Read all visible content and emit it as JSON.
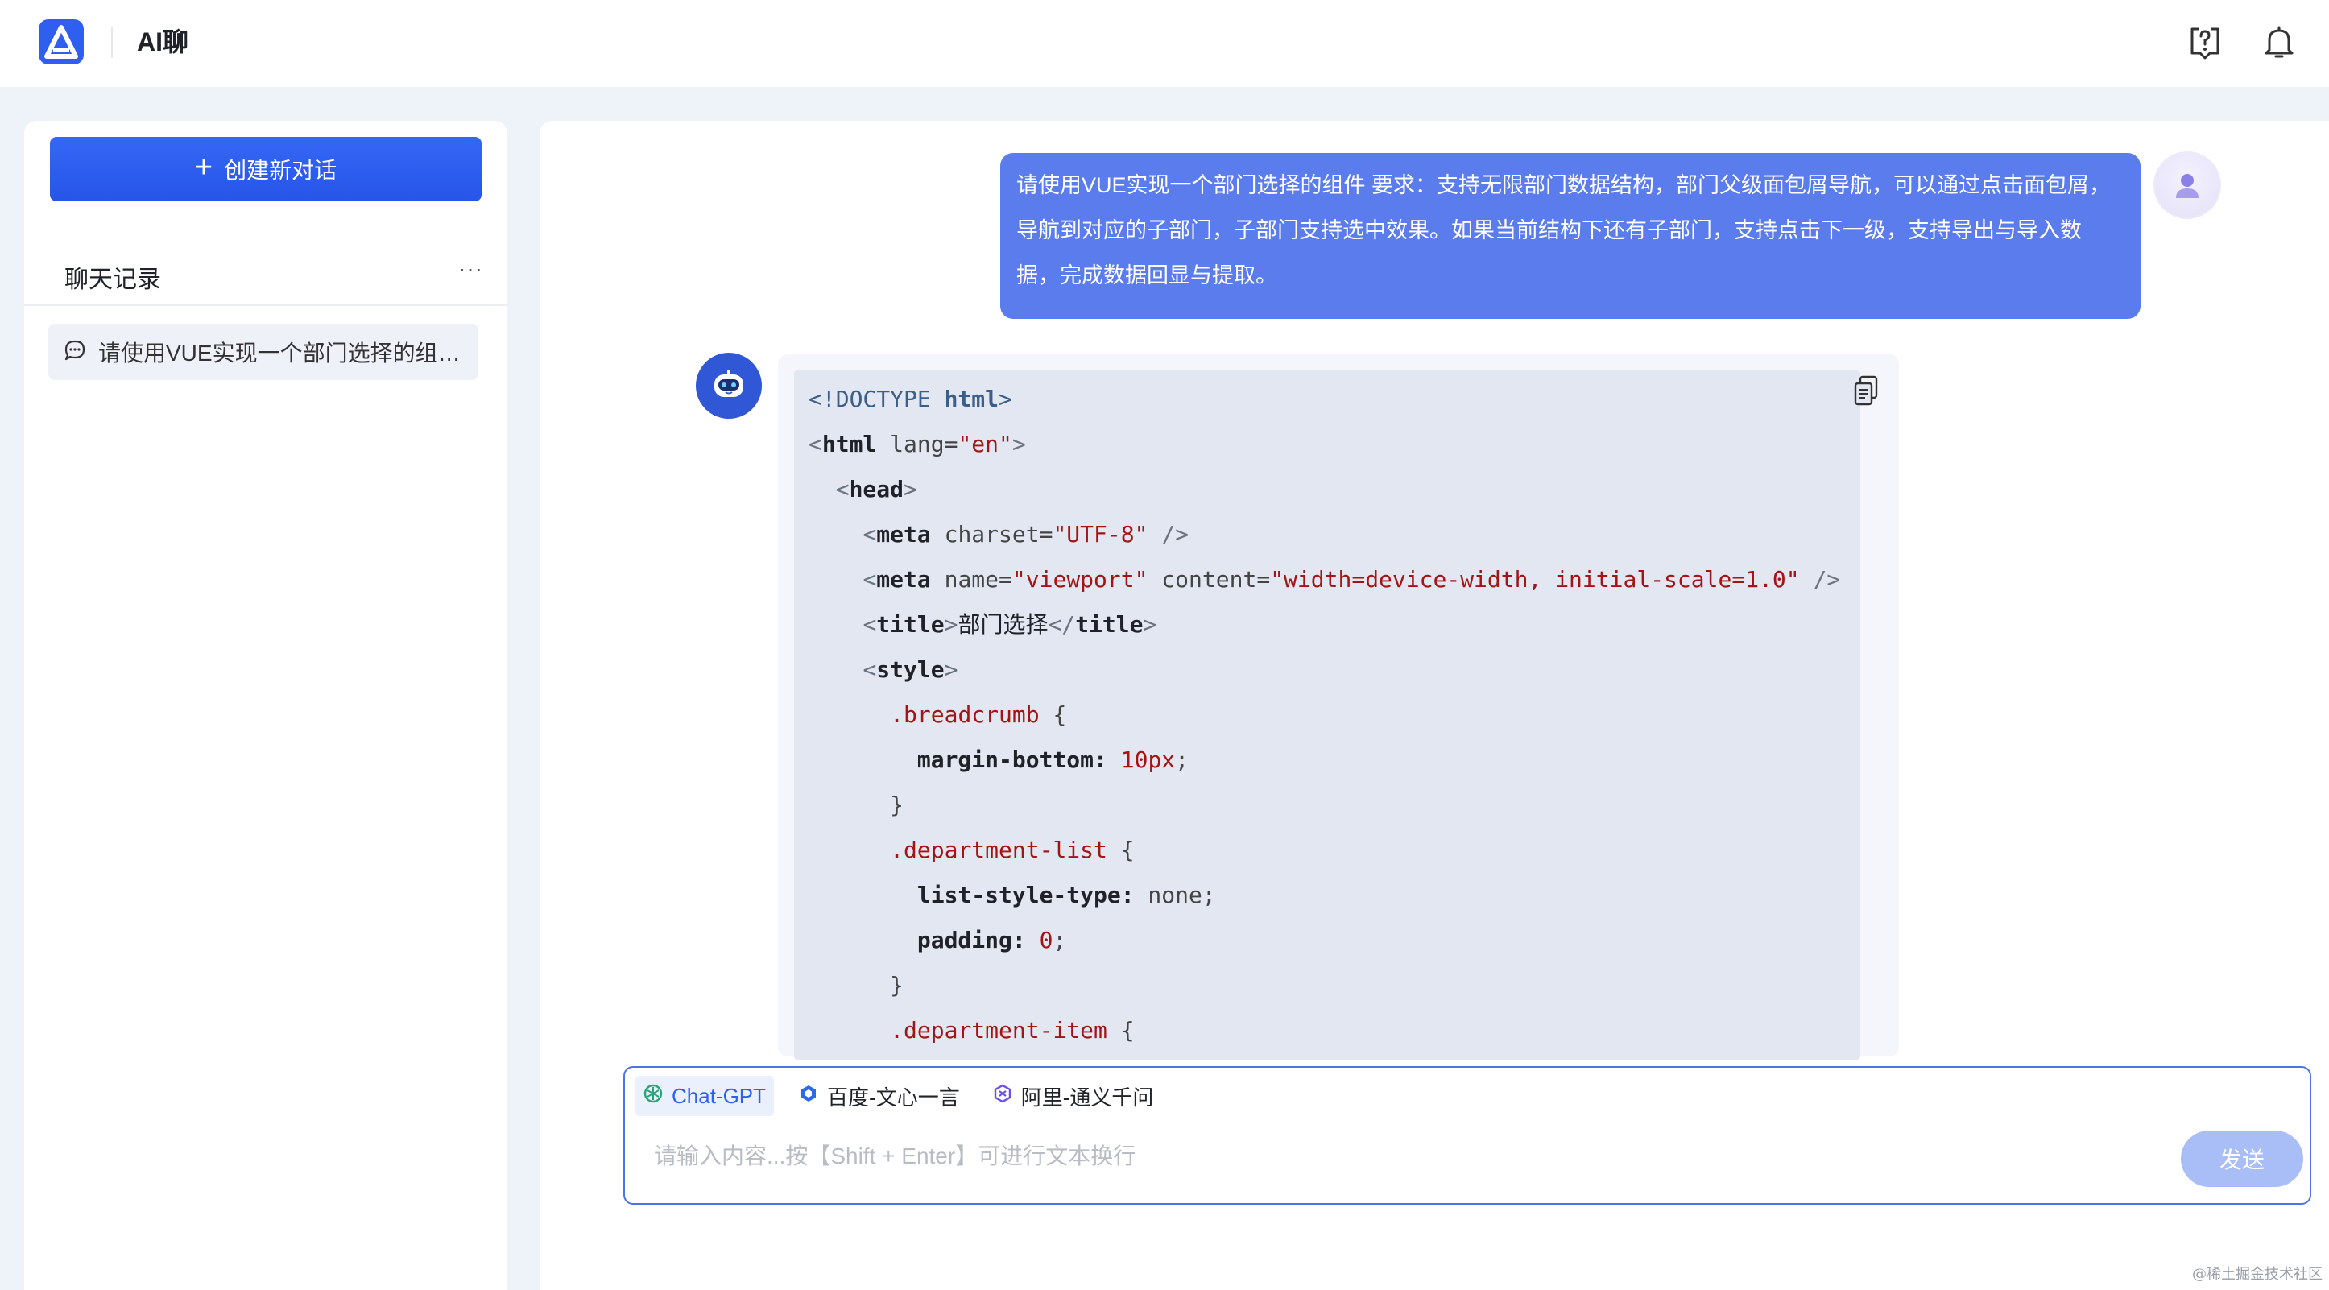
{
  "app": {
    "title": "AI聊",
    "logo_icon": "logo-a-icon",
    "help_icon": "help-question-icon",
    "bell_icon": "bell-icon"
  },
  "sidebar": {
    "new_chat_label": "创建新对话",
    "history_title": "聊天记录",
    "history_more": "···",
    "items": [
      {
        "label": "请使用VUE实现一个部门选择的组件 要求：支持无限部门数据结构，部门父级面包屑导航，可以通过点击面包屑，导航到对应的子部门，子部门支持选中效果。如果当前结构下还有子部门，支持点击下一级，支持导出与导入数据，完成数据回显与提取。",
        "icon": "chat-bubble-icon"
      }
    ]
  },
  "conversation": {
    "user_message": "请使用VUE实现一个部门选择的组件 要求：支持无限部门数据结构，部门父级面包屑导航，可以通过点击面包屑，导航到对应的子部门，子部门支持选中效果。如果当前结构下还有子部门，支持点击下一级，支持导出与导入数据，完成数据回显与提取。",
    "code": {
      "l1_a": "<!DOCTYPE ",
      "l1_b": "html",
      "l1_c": ">",
      "l2_a": "<",
      "l2_tag": "html",
      "l2_attr": " lang=",
      "l2_val": "\"en\"",
      "l2_end": ">",
      "l3_a": "<",
      "l3_tag": "head",
      "l3_end": ">",
      "l4_a": "<",
      "l4_tag": "meta",
      "l4_attr": " charset=",
      "l4_val": "\"UTF-8\"",
      "l4_end": " />",
      "l5_a": "<",
      "l5_tag": "meta",
      "l5_attr": " name=",
      "l5_val": "\"viewport\"",
      "l5_attr2": " content=",
      "l5_val2": "\"width=device-width, initial-scale=1.0\"",
      "l5_end": " />",
      "l6_a": "<",
      "l6_tag": "title",
      "l6_mid": ">",
      "l6_text": "部门选择",
      "l6_close": "</",
      "l6_tag2": "title",
      "l6_end": ">",
      "l7_a": "<",
      "l7_tag": "style",
      "l7_end": ">",
      "l8_sel": ".breadcrumb",
      "l8_brace": " {",
      "l9_prop": "margin-bottom:",
      "l9_val": " 10px",
      "l9_end": ";",
      "l10": "}",
      "l11_sel": ".department-list",
      "l11_brace": " {",
      "l12_prop": "list-style-type:",
      "l12_val": " none;",
      "l13_prop": "padding:",
      "l13_val": " 0",
      "l13_end": ";",
      "l14": "}",
      "l15_sel": ".department-item",
      "l15_brace": " {"
    }
  },
  "input": {
    "models": [
      {
        "label": "Chat-GPT",
        "icon": "openai-icon",
        "active": true
      },
      {
        "label": "百度-文心一言",
        "icon": "wenxin-icon",
        "active": false
      },
      {
        "label": "阿里-通义千问",
        "icon": "tongyi-icon",
        "active": false
      }
    ],
    "placeholder": "请输入内容...按【Shift + Enter】可进行文本换行",
    "value": "",
    "send_label": "发送"
  },
  "watermark": "@稀土掘金技术社区",
  "colors": {
    "primary": "#2f5ff0",
    "user_bubble": "#5b7cec",
    "code_bg": "#e2e7f1",
    "send_disabled": "#a9bdf6"
  }
}
